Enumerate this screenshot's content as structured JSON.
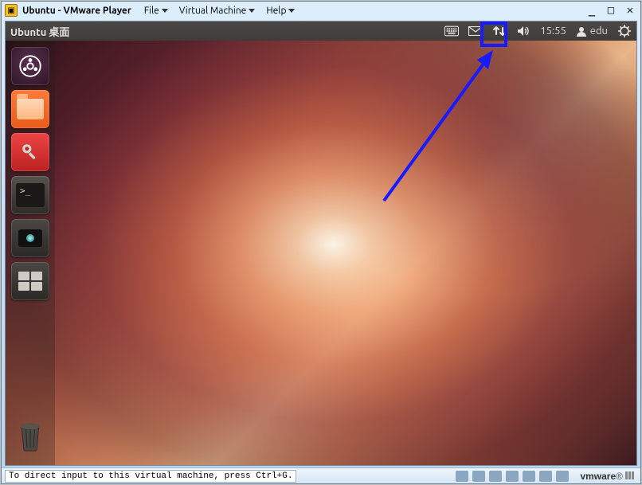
{
  "vmware": {
    "title": "Ubuntu - VMware Player",
    "menus": [
      "File",
      "Virtual Machine",
      "Help"
    ],
    "status_message": "To direct input to this virtual machine, press Ctrl+G.",
    "brand": "vmware"
  },
  "ubuntu": {
    "topbar_title": "Ubuntu 桌面",
    "clock": "15:55",
    "username": "edu",
    "indicators": {
      "keyboard": "keyboard-icon",
      "messages": "mail-icon",
      "network": "network-updown-icon",
      "volume": "volume-icon",
      "session": "power-cog-icon"
    },
    "launcher": [
      {
        "name": "dash-home",
        "label": "Dash Home"
      },
      {
        "name": "files",
        "label": "Files"
      },
      {
        "name": "system-settings",
        "label": "System Settings"
      },
      {
        "name": "terminal",
        "label": "Terminal"
      },
      {
        "name": "cheese-webcam",
        "label": "Webcam"
      },
      {
        "name": "workspace-switcher",
        "label": "Workspace Switcher"
      }
    ],
    "trash_label": "Trash"
  },
  "annotation": {
    "target": "network-indicator",
    "color": "#1a1aff"
  }
}
